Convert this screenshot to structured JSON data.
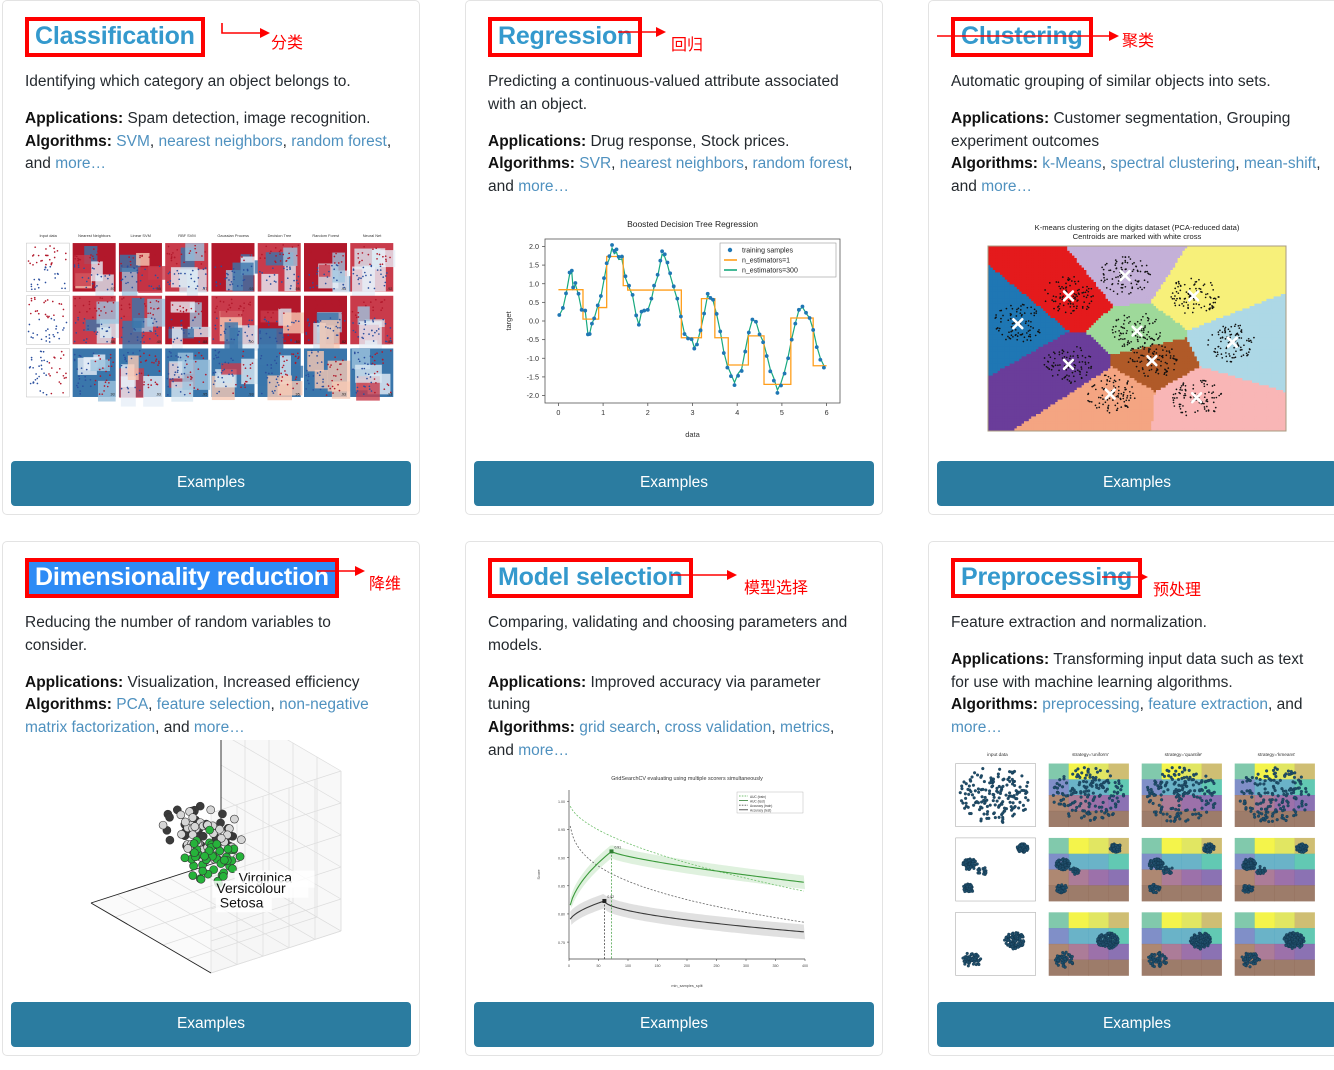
{
  "theme": {
    "title_color": "#3499cd",
    "link_color": "#4f91bf",
    "button_color": "#2b7ca0",
    "annotation_color": "#ff0000",
    "selection_color": "#2e8bf5"
  },
  "cards": [
    {
      "id": "classification",
      "title": "Classification",
      "annotation_cn": "分类",
      "description": "Identifying which category an object belongs to.",
      "applications_label": "Applications:",
      "applications": "Spam detection, image recognition.",
      "algorithms_label": "Algorithms:",
      "algorithms": [
        "SVM",
        "nearest neighbors",
        "random forest"
      ],
      "algorithms_tail": "and",
      "more_label": "more…",
      "button_label": "Examples",
      "thumbnail": {
        "kind": "classifier-comparison-grid",
        "columns": [
          "Input data",
          "Nearest Neighbors",
          "Linear SVM",
          "RBF SVM",
          "Gaussian Process",
          "Decision Tree",
          "Random Forest",
          "Neural Net"
        ],
        "rows": 3,
        "scores": [
          [
            null,
            ".97",
            ".95",
            ".97",
            ".93",
            ".95",
            ".93",
            ".92"
          ],
          [
            null,
            ".88",
            ".40",
            ".88",
            ".90",
            ".80",
            ".82",
            ".85"
          ],
          [
            null,
            ".93",
            ".93",
            ".95",
            ".93",
            ".95",
            ".93",
            ".93"
          ]
        ]
      }
    },
    {
      "id": "regression",
      "title": "Regression",
      "annotation_cn": "回归",
      "description": "Predicting a continuous-valued attribute associated with an object.",
      "applications_label": "Applications:",
      "applications": "Drug response, Stock prices.",
      "algorithms_label": "Algorithms:",
      "algorithms": [
        "SVR",
        "nearest neighbors",
        "random forest"
      ],
      "algorithms_tail": "and",
      "more_label": "more…",
      "button_label": "Examples",
      "thumbnail": {
        "kind": "chart",
        "chart_ref": 0
      }
    },
    {
      "id": "clustering",
      "title": "Clustering",
      "annotation_cn": "聚类",
      "description": "Automatic grouping of similar objects into sets.",
      "applications_label": "Applications:",
      "applications": "Customer segmentation, Grouping experiment outcomes",
      "algorithms_label": "Algorithms:",
      "algorithms": [
        "k-Means",
        "spectral clustering",
        "mean-shift"
      ],
      "algorithms_tail": "and",
      "more_label": "more…",
      "button_label": "Examples",
      "thumbnail": {
        "kind": "kmeans-voronoi",
        "title_line1": "K-means clustering on the digits dataset (PCA-reduced data)",
        "title_line2": "Centroids are marked with white cross",
        "n_clusters": 10,
        "cluster_colors": [
          "#1f77b4",
          "#e41a1c",
          "#c4b0d8",
          "#9ed99a",
          "#f7f07a",
          "#add8e6",
          "#6a3d9a",
          "#b05a28",
          "#f4a582",
          "#f9b6b6"
        ]
      }
    },
    {
      "id": "dimensionality-reduction",
      "title": "Dimensionality reduction",
      "annotation_cn": "降维",
      "selected": true,
      "description": "Reducing the number of random variables to consider.",
      "applications_label": "Applications:",
      "applications": "Visualization, Increased efficiency",
      "algorithms_label": "Algorithms:",
      "algorithms": [
        "PCA",
        "feature selection",
        "non-negative matrix factorization"
      ],
      "algorithms_tail": "and",
      "more_label": "more…",
      "button_label": "Examples",
      "thumbnail": {
        "kind": "iris-pca-3d",
        "class_labels": [
          "Virginica",
          "Versicolour",
          "Setosa"
        ]
      }
    },
    {
      "id": "model-selection",
      "title": "Model selection",
      "annotation_cn": "模型选择",
      "description": "Comparing, validating and choosing parameters and models.",
      "applications_label": "Applications:",
      "applications": "Improved accuracy via parameter tuning",
      "algorithms_label": "Algorithms:",
      "algorithms": [
        "grid search",
        "cross validation",
        "metrics"
      ],
      "algorithms_tail": "and",
      "more_label": "more…",
      "button_label": "Examples",
      "thumbnail": {
        "kind": "chart",
        "chart_ref": 1
      }
    },
    {
      "id": "preprocessing",
      "title": "Preprocessing",
      "annotation_cn": "预处理",
      "description": "Feature extraction and normalization.",
      "applications_label": "Applications:",
      "applications": "Transforming input data such as text for use with machine learning algorithms.",
      "algorithms_label": "Algorithms:",
      "algorithms": [
        "preprocessing",
        "feature extraction"
      ],
      "algorithms_tail": "and",
      "more_label": "more…",
      "button_label": "Examples",
      "thumbnail": {
        "kind": "kbins-grid",
        "columns": [
          "input data",
          "strategy='uniform'",
          "strategy='quantile'",
          "strategy='kmeans'"
        ],
        "rows": 3
      }
    }
  ],
  "chart_data": [
    {
      "type": "scatter",
      "title": "Boosted Decision Tree Regression",
      "xlabel": "data",
      "ylabel": "target",
      "xlim": [
        -0.3,
        6.3
      ],
      "ylim": [
        -2.2,
        2.2
      ],
      "xticks": [
        "0",
        "1",
        "2",
        "3",
        "4",
        "5",
        "6"
      ],
      "yticks": [
        "-2.0",
        "-1.5",
        "-1.0",
        "-0.5",
        "0.0",
        "0.5",
        "1.0",
        "1.5",
        "2.0"
      ],
      "grid": false,
      "legend_position": "top-right",
      "legend": [
        {
          "name": "training samples",
          "color": "#1f77b4",
          "marker": "dot"
        },
        {
          "name": "n_estimators=1",
          "color": "#ff9e1b",
          "marker": "line"
        },
        {
          "name": "n_estimators=300",
          "color": "#17a97f",
          "marker": "line"
        }
      ],
      "series": [
        {
          "name": "training samples",
          "x": [
            0.02,
            0.1,
            0.17,
            0.25,
            0.3,
            0.33,
            0.38,
            0.45,
            0.52,
            0.6,
            0.66,
            0.7,
            0.75,
            0.8,
            0.88,
            0.95,
            1.02,
            1.08,
            1.14,
            1.2,
            1.25,
            1.3,
            1.35,
            1.42,
            1.5,
            1.58,
            1.66,
            1.74,
            1.8,
            1.86,
            1.92,
            2.0,
            2.08,
            2.14,
            2.22,
            2.28,
            2.32,
            2.38,
            2.44,
            2.5,
            2.58,
            2.66,
            2.74,
            2.82,
            2.9,
            2.98,
            3.04,
            3.1,
            3.18,
            3.26,
            3.34,
            3.4,
            3.46,
            3.54,
            3.62,
            3.7,
            3.78,
            3.86,
            3.94,
            4.02,
            4.1,
            4.18,
            4.26,
            4.34,
            4.42,
            4.5,
            4.58,
            4.66,
            4.74,
            4.82,
            4.9,
            4.98,
            5.06,
            5.14,
            5.22,
            5.3,
            5.38,
            5.46,
            5.54,
            5.62,
            5.7,
            5.78,
            5.86,
            5.94
          ],
          "y": [
            0.16,
            0.35,
            0.74,
            1.3,
            1.35,
            0.9,
            1.02,
            0.73,
            0.3,
            0.28,
            -0.36,
            -0.35,
            -0.07,
            0.07,
            0.42,
            0.67,
            1.15,
            1.55,
            1.74,
            2.04,
            1.88,
            1.92,
            1.72,
            1.73,
            1.2,
            0.95,
            0.7,
            0.15,
            -0.1,
            0.25,
            0.28,
            0.3,
            0.6,
            0.95,
            1.24,
            1.62,
            1.87,
            1.79,
            1.57,
            1.28,
            0.93,
            0.6,
            0.12,
            -0.35,
            -0.47,
            -0.49,
            -0.74,
            -0.63,
            -0.25,
            0.2,
            0.73,
            0.62,
            0.57,
            0.19,
            -0.28,
            -0.86,
            -1.25,
            -1.48,
            -1.72,
            -1.47,
            -1.34,
            -0.82,
            -0.31,
            0.04,
            -0.02,
            -0.36,
            -0.57,
            -0.94,
            -1.35,
            -1.6,
            -1.93,
            -1.73,
            -1.41,
            -1.0,
            -0.5,
            -0.07,
            0.3,
            0.39,
            0.22,
            0.08,
            -0.24,
            -0.7,
            -1.04,
            -1.25
          ]
        },
        {
          "name": "n_estimators=1",
          "color": "#ff9e1b",
          "step": true
        },
        {
          "name": "n_estimators=300",
          "color": "#17a97f",
          "step": false
        }
      ]
    },
    {
      "type": "line",
      "title": "GridSearchCV evaluating using multiple scorers simultaneously",
      "xlabel": "min_samples_split",
      "ylabel": "Score",
      "xlim": [
        0,
        400
      ],
      "ylim": [
        0.72,
        1.02
      ],
      "xticks": [
        "0",
        "50",
        "100",
        "150",
        "200",
        "250",
        "300",
        "350",
        "400"
      ],
      "yticks": [
        "1.00",
        "0.95",
        "0.90",
        "0.85",
        "0.80",
        "0.75"
      ],
      "grid": false,
      "legend_position": "top-right",
      "legend": [
        {
          "name": "AUC (train)",
          "color": "#4daf4a",
          "style": "dashed"
        },
        {
          "name": "AUC (test)",
          "color": "#2e7d32",
          "style": "solid"
        },
        {
          "name": "Accuracy (train)",
          "color": "#555555",
          "style": "dashed"
        },
        {
          "name": "Accuracy (test)",
          "color": "#333333",
          "style": "solid"
        }
      ],
      "annotations": [
        {
          "label": "0.91",
          "series": "AUC (test)"
        },
        {
          "label": "0.82",
          "series": "Accuracy (test)"
        }
      ]
    }
  ]
}
